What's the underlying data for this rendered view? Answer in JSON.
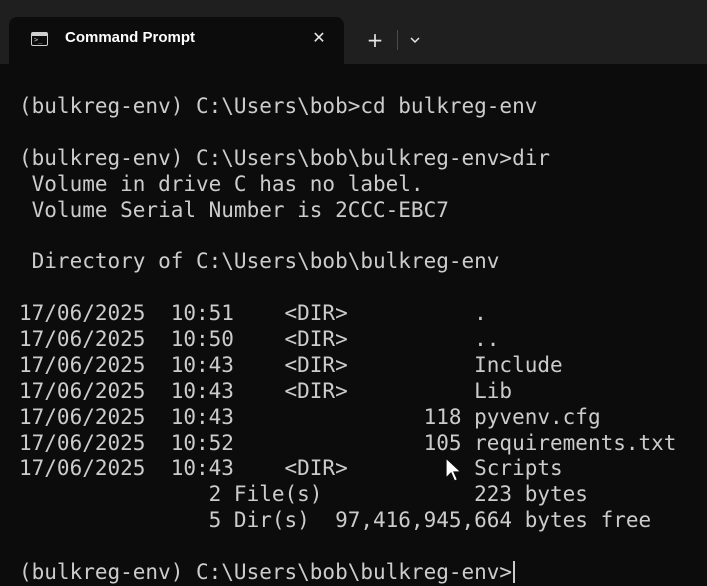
{
  "window": {
    "tab_title": "Command Prompt",
    "tab_icon": "terminal-icon",
    "close_glyph": "✕",
    "new_tab_glyph": "+",
    "dropdown_icon": "chevron-down-icon"
  },
  "terminal": {
    "lines": [
      "(bulkreg-env) C:\\Users\\bob>cd bulkreg-env",
      "",
      "(bulkreg-env) C:\\Users\\bob\\bulkreg-env>dir",
      " Volume in drive C has no label.",
      " Volume Serial Number is 2CCC-EBC7",
      "",
      " Directory of C:\\Users\\bob\\bulkreg-env",
      "",
      "17/06/2025  10:51    <DIR>          .",
      "17/06/2025  10:50    <DIR>          ..",
      "17/06/2025  10:43    <DIR>          Include",
      "17/06/2025  10:43    <DIR>          Lib",
      "17/06/2025  10:43               118 pyvenv.cfg",
      "17/06/2025  10:52               105 requirements.txt",
      "17/06/2025  10:43    <DIR>          Scripts",
      "               2 File(s)            223 bytes",
      "               5 Dir(s)  97,416,945,664 bytes free",
      "",
      "(bulkreg-env) C:\\Users\\bob\\bulkreg-env>"
    ]
  },
  "colors": {
    "terminal_bg": "#0c0c0c",
    "titlebar_bg": "#1f1f1f",
    "text": "#cccccc"
  }
}
